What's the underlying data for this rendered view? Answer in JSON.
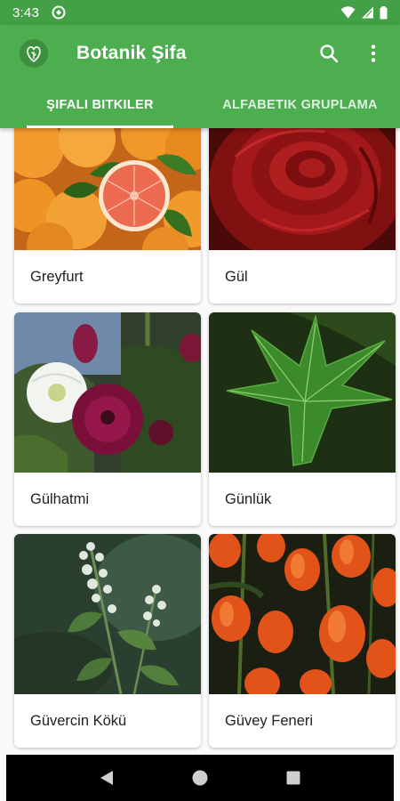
{
  "status_bar": {
    "time": "3:43"
  },
  "app_bar": {
    "title": "Botanik Şifa",
    "background": "#4caf50",
    "actions": [
      {
        "icon": "search-icon"
      },
      {
        "icon": "more-vert-icon"
      }
    ]
  },
  "tabs": [
    {
      "label": "ŞIFALI BITKILER",
      "active": true
    },
    {
      "label": "ALFABETIK GRUPLAMA",
      "active": false
    }
  ],
  "plants": [
    {
      "name": "Greyfurt",
      "image": "grapefruit"
    },
    {
      "name": "Gül",
      "image": "red-rose"
    },
    {
      "name": "Gülhatmi",
      "image": "hollyhock"
    },
    {
      "name": "Günlük",
      "image": "sweetgum-leaf"
    },
    {
      "name": "Güvercin Kökü",
      "image": "basil"
    },
    {
      "name": "Güvey Feneri",
      "image": "physalis-lanterns"
    }
  ],
  "nav_bar": [
    {
      "icon": "back-icon"
    },
    {
      "icon": "home-icon"
    },
    {
      "icon": "recents-icon"
    }
  ]
}
